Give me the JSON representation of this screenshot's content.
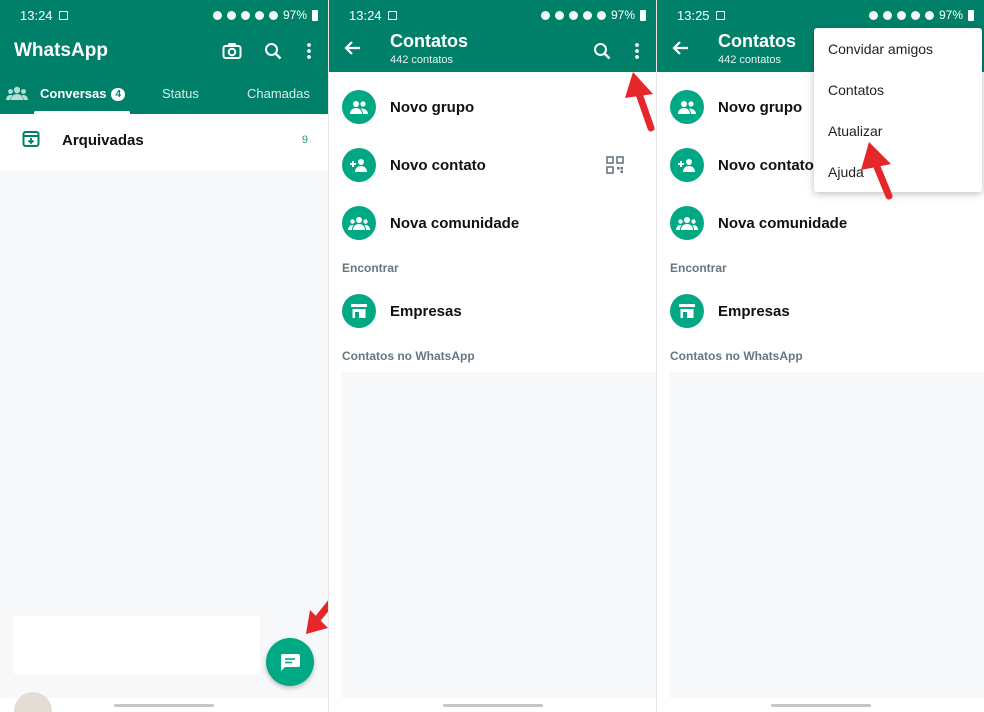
{
  "colors": {
    "primary": "#008069",
    "accent": "#00a884",
    "arrow": "#e5262a"
  },
  "panel1": {
    "status": {
      "time": "13:24",
      "battery": "97%"
    },
    "app_title": "WhatsApp",
    "tabs": {
      "chats": "Conversas",
      "chats_badge": "4",
      "status": "Status",
      "calls": "Chamadas"
    },
    "archived": {
      "label": "Arquivadas",
      "count": "9"
    },
    "fab_icon": "message-icon"
  },
  "panel2": {
    "status": {
      "time": "13:24",
      "battery": "97%"
    },
    "title": "Contatos",
    "subtitle": "442 contatos",
    "rows": {
      "new_group": "Novo grupo",
      "new_contact": "Novo contato",
      "new_community": "Nova comunidade",
      "businesses": "Empresas"
    },
    "sections": {
      "find": "Encontrar",
      "contacts_on_whatsapp": "Contatos no WhatsApp"
    }
  },
  "panel3": {
    "status": {
      "time": "13:25",
      "battery": "97%"
    },
    "title": "Contatos",
    "subtitle": "442 contatos",
    "rows": {
      "new_group": "Novo grupo",
      "new_contact": "Novo contato",
      "new_community": "Nova comunidade",
      "businesses": "Empresas"
    },
    "sections": {
      "find": "Encontrar",
      "contacts_on_whatsapp": "Contatos no WhatsApp"
    },
    "menu": {
      "invite": "Convidar amigos",
      "contacts": "Contatos",
      "refresh": "Atualizar",
      "help": "Ajuda"
    }
  }
}
